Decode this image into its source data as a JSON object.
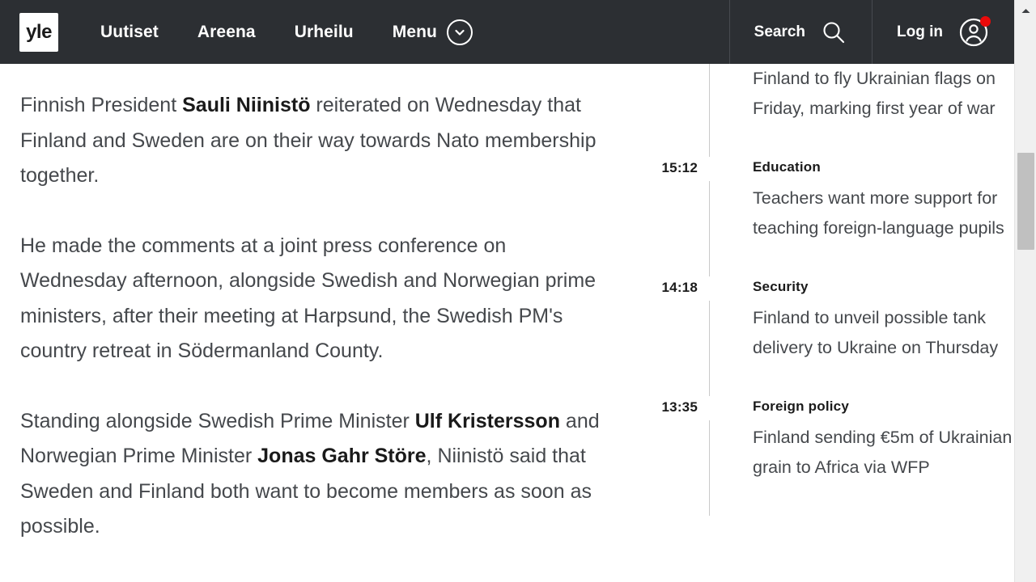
{
  "header": {
    "logo_text": "yle",
    "nav": [
      {
        "label": "Uutiset",
        "name": "nav-uutiset"
      },
      {
        "label": "Areena",
        "name": "nav-areena"
      },
      {
        "label": "Urheilu",
        "name": "nav-urheilu"
      }
    ],
    "menu_label": "Menu",
    "search_label": "Search",
    "login_label": "Log in",
    "bg_color": "#2c2f33",
    "notification_color": "#ea0a0a"
  },
  "article": {
    "paragraphs": [
      {
        "segments": [
          {
            "text": "Finnish President ",
            "bold": false
          },
          {
            "text": "Sauli Niinistö",
            "bold": true
          },
          {
            "text": " reiterated on Wednesday that Finland and Sweden are on their way towards Nato membership together.",
            "bold": false
          }
        ]
      },
      {
        "segments": [
          {
            "text": "He made the comments at a joint press conference on Wednesday afternoon, alongside Swedish and Norwegian prime ministers, after their meeting at Harpsund, the Swedish PM's country retreat in Södermanland County.",
            "bold": false
          }
        ]
      },
      {
        "segments": [
          {
            "text": "Standing alongside Swedish Prime Minister ",
            "bold": false
          },
          {
            "text": "Ulf Kristersson",
            "bold": true
          },
          {
            "text": " and Norwegian Prime Minister ",
            "bold": false
          },
          {
            "text": "Jonas Gahr Störe",
            "bold": true
          },
          {
            "text": ", Niinistö said that Sweden and Finland both want to become members as soon as possible.",
            "bold": false
          }
        ]
      }
    ]
  },
  "sidebar": {
    "items": [
      {
        "time": "",
        "category": "",
        "headline": "Finland to fly Ukrainian flags on Friday, marking first year of war",
        "partial": true
      },
      {
        "time": "15:12",
        "category": "Education",
        "headline": "Teachers want more support for teaching foreign-language pupils",
        "partial": false
      },
      {
        "time": "14:18",
        "category": "Security",
        "headline": "Finland to unveil possible tank delivery to Ukraine on Thursday",
        "partial": false
      },
      {
        "time": "13:35",
        "category": "Foreign policy",
        "headline": "Finland sending €5m of Ukrainian grain to Africa via WFP",
        "partial": false
      }
    ]
  },
  "scrollbar": {
    "up_arrow": "scroll-up-arrow",
    "thumb": "scroll-thumb"
  }
}
